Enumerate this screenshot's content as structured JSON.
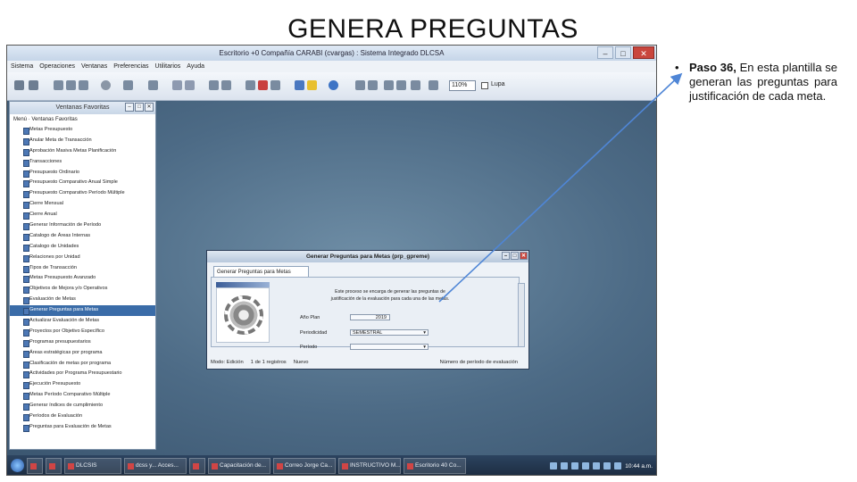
{
  "slide": {
    "title": "GENERA PREGUNTAS"
  },
  "bullet": {
    "dot": "•",
    "step": "Paso 36,",
    "text": " En esta plantilla se generan las preguntas para justificación de cada meta."
  },
  "app": {
    "window_title": "Escritorio +0 Compañía CARABI (cvargas) : Sistema Integrado DLCSA",
    "menu": [
      "Sistema",
      "Operaciones",
      "Ventanas",
      "Preferencias",
      "Utilitarios",
      "Ayuda"
    ],
    "zoom": "110%",
    "lupa_label": "Lupa"
  },
  "favorites": {
    "title": "Ventanas Favoritas",
    "root": "Menú · Ventanas Favoritas",
    "items": [
      "Metas Presupuesto",
      "Anular Meta de Transacción",
      "Aprobación Masiva Metas Planificación",
      "Transacciones",
      "Presupuesto Ordinario",
      "Presupuesto Comparativo Anual Simple",
      "Presupuesto Comparativo Período Múltiple",
      "Cierre Mensual",
      "Cierre Anual",
      "Generar Información de Período",
      "Catalogo de Áreas Internas",
      "Catalogo de Unidades",
      "Relaciones por Unidad",
      "Tipos de Transacción",
      "Metas Presupuesto Avanzado",
      "Objetivos de Mejora y/o Operativos",
      "Evaluación de Metas",
      "Generar Preguntas para Metas",
      "Actualizar Evaluación de Metas",
      "Proyectos por Objetivo Específico",
      "Programas presupuestarios",
      "Áreas estratégicas por programa",
      "Clasificación de metas por programa",
      "Actividades por Programa Presupuestario",
      "Ejecución Presupuesto",
      "Metas Período Comparativo Múltiple",
      "Generar índices de cumplimiento",
      "Períodos de Evaluación",
      "Preguntas para Evaluación de Metas"
    ],
    "selected_index": 17
  },
  "dialog": {
    "title": "Generar Preguntas para Metas (prp_gpreme)",
    "tab": "Generar Preguntas para Metas",
    "message": "Este proceso se encarga de generar las preguntas de justificación de la evaluación para cada una de las metas.",
    "fields": {
      "anio_label": "Año Plan",
      "anio_value": "2019",
      "periodicidad_label": "Periodicidad",
      "periodicidad_value": "SEMESTRAL",
      "periodo_label": "Período",
      "periodo_value": ""
    },
    "status": [
      "Modo: Edición",
      "1 de 1 registros",
      "Nuevo"
    ],
    "status_right": "Número de período de evaluación"
  },
  "taskbar": {
    "tasks": [
      "DLCSIS",
      "dcss y... Acces...",
      "Capacitación de...",
      "Correo Jorge Ca...",
      "INSTRUCTIVO M...",
      "Escritorio 40 Co..."
    ],
    "clock": "10:44 a.m."
  },
  "colors": {
    "arrow": "#4f86d6",
    "selected": "#3a6ca8"
  }
}
